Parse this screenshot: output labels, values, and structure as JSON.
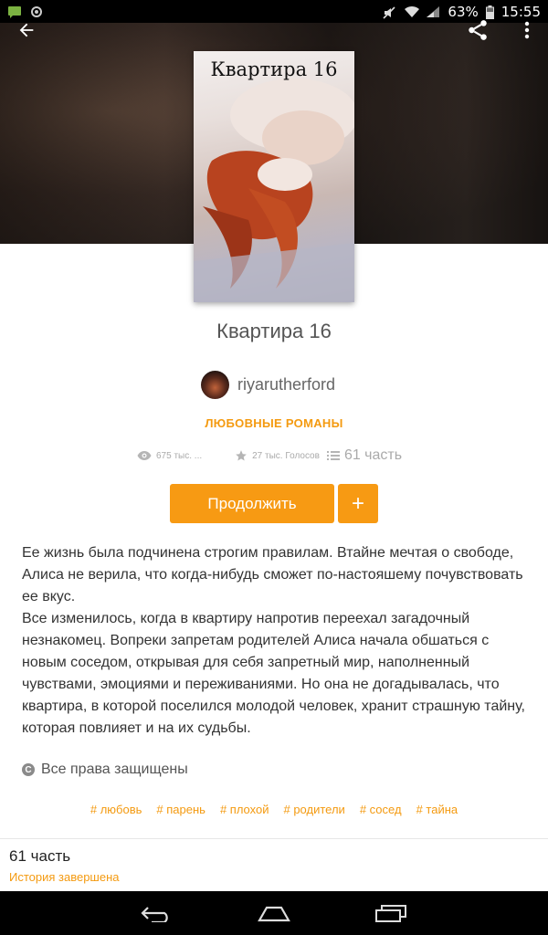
{
  "status_bar": {
    "battery": "63%",
    "time": "15:55",
    "icons": [
      "chat-icon",
      "sync-icon",
      "mute-icon",
      "wifi-icon",
      "signal-icon",
      "battery-icon"
    ]
  },
  "header": {
    "back_icon": "arrow-left-icon",
    "share_icon": "share-icon",
    "more_icon": "more-vertical-icon"
  },
  "book": {
    "cover_title": "Квартира 16",
    "title": "Квартира 16",
    "author": "riyarutherford",
    "genre": "ЛЮБОВНЫЕ РОМАНЫ",
    "views": "675 тыс. ...",
    "votes": "27 тыс. Голосов",
    "parts": "61 часть"
  },
  "actions": {
    "continue_label": "Продолжить",
    "add_label": "+"
  },
  "description": {
    "paragraph1": "Ее жизнь была подчинена строгим правилам. Втайне мечтая о свободе, Алиса не верила, что когда-нибудь сможет по-настояшему почувствовать ее вкус.",
    "paragraph2": "Все изменилось, когда в квартиру напротив переехал загадочный незнакомец. Вопреки запретам родителей Алиса начала обшаться с новым соседом, открывая для себя запретный мир, наполненный чувствами, эмоциями и переживаниями. Но она не догадывалась, что квартира, в которой поселился молодой человек, хранит страшную тайну, которая повлияет и на их судьбы."
  },
  "rights": {
    "label": "Все права защищены"
  },
  "tags": [
    "# любовь",
    "# парень",
    "# плохой",
    "# родители",
    "# сосед",
    "# тайна"
  ],
  "footer": {
    "parts_count": "61 часть",
    "status": "История завершена"
  },
  "colors": {
    "accent": "#f79a13",
    "accent_text": "#f49a10"
  }
}
